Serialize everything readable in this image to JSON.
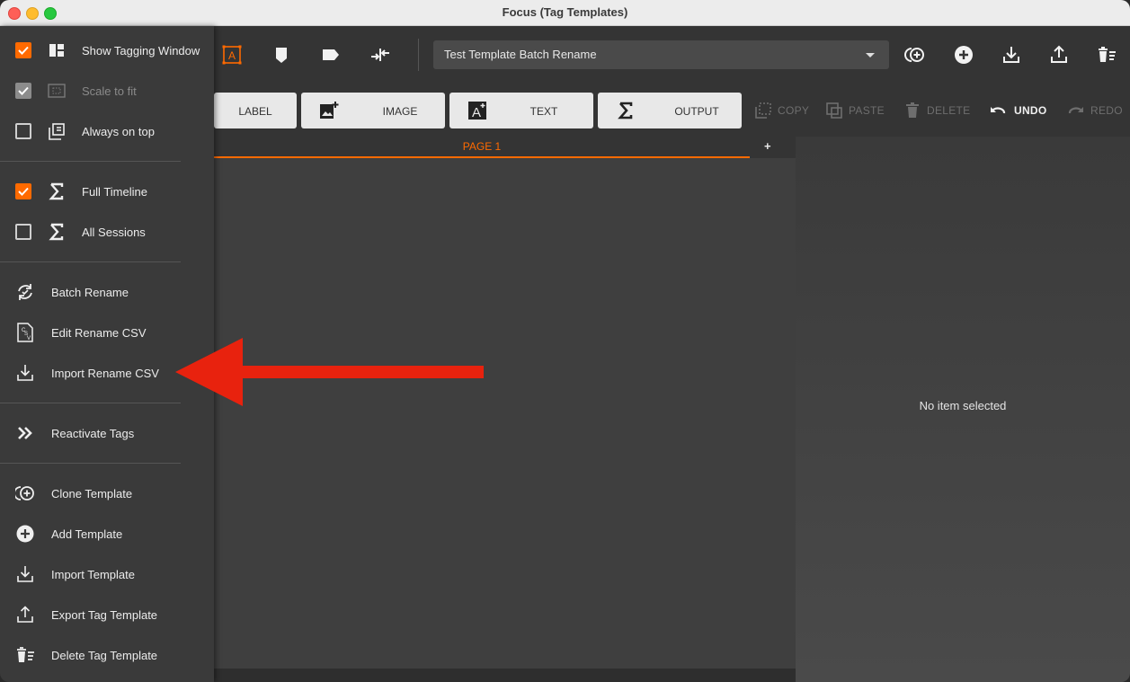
{
  "window": {
    "title": "Focus (Tag Templates)"
  },
  "toolbar": {
    "template_select": {
      "value": "Test Template Batch Rename"
    },
    "icons": [
      "template-tag-icon",
      "shield-tag-icon",
      "label-tag-icon",
      "merge-arrows-icon",
      "clone-icon",
      "add-icon",
      "import-icon",
      "export-icon",
      "delete-list-icon"
    ]
  },
  "buttons": {
    "label": "LABEL",
    "image": "IMAGE",
    "text": "TEXT",
    "output": "OUTPUT"
  },
  "actions": {
    "copy": "COPY",
    "paste": "PASTE",
    "delete": "DELETE",
    "undo": "UNDO",
    "redo": "REDO"
  },
  "tabs": {
    "page1": "PAGE 1",
    "add": "+"
  },
  "right_panel": {
    "empty_message": "No item selected"
  },
  "menu": {
    "view": [
      {
        "label": "Show Tagging Window",
        "checked": true,
        "enabled": true,
        "icon": "layout-icon"
      },
      {
        "label": "Scale to fit",
        "checked": true,
        "enabled": false,
        "icon": "scale-fit-icon"
      },
      {
        "label": "Always on top",
        "checked": false,
        "enabled": true,
        "icon": "always-on-top-icon"
      }
    ],
    "timeline": [
      {
        "label": "Full Timeline",
        "checked": true,
        "icon": "sigma-icon"
      },
      {
        "label": "All Sessions",
        "checked": false,
        "icon": "sigma-icon"
      }
    ],
    "rename": [
      {
        "label": "Batch Rename",
        "icon": "batch-rename-icon"
      },
      {
        "label": "Edit Rename CSV",
        "icon": "csv-file-icon"
      },
      {
        "label": "Import Rename CSV",
        "icon": "import-icon"
      }
    ],
    "tags": [
      {
        "label": "Reactivate Tags",
        "icon": "double-chevron-icon"
      }
    ],
    "templates": [
      {
        "label": "Clone Template",
        "icon": "clone-icon"
      },
      {
        "label": "Add Template",
        "icon": "add-icon"
      },
      {
        "label": "Import Template",
        "icon": "import-icon"
      },
      {
        "label": "Export Tag Template",
        "icon": "export-icon"
      },
      {
        "label": "Delete Tag Template",
        "icon": "delete-list-icon"
      }
    ]
  },
  "colors": {
    "accent": "#ff6a00",
    "annotation_arrow": "#e8220e"
  }
}
